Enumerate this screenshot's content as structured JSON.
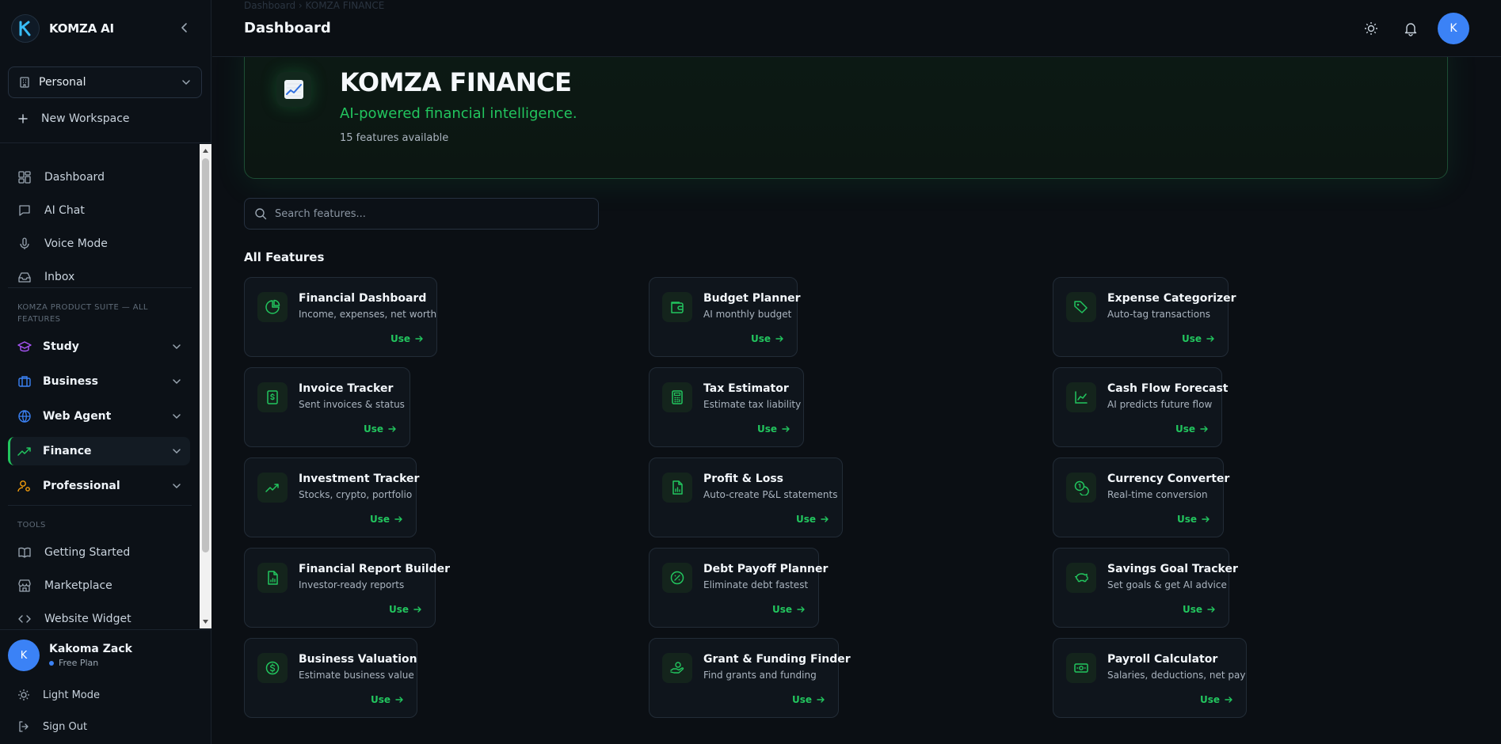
{
  "colors": {
    "accent": "#22c55e",
    "avatar": "#3b82f6",
    "background": "#0b0f14"
  },
  "brand": {
    "name": "KOMZA AI",
    "logo_letter": "K"
  },
  "sidebar": {
    "workspace": {
      "selected": "Personal"
    },
    "new_workspace": "New Workspace",
    "nav": [
      {
        "label": "Dashboard",
        "icon": "dashboard-icon"
      },
      {
        "label": "AI Chat",
        "icon": "chat-icon"
      },
      {
        "label": "Voice Mode",
        "icon": "microphone-icon"
      },
      {
        "label": "Inbox",
        "icon": "inbox-icon"
      }
    ],
    "suite_caption_line1": "KOMZA PRODUCT SUITE — ALL",
    "suite_caption_line2": "FEATURES",
    "categories": [
      {
        "label": "Study",
        "icon": "graduation-cap-icon",
        "color": "#a855f7"
      },
      {
        "label": "Business",
        "icon": "briefcase-icon",
        "color": "#3b82f6"
      },
      {
        "label": "Web Agent",
        "icon": "globe-icon",
        "color": "#3b82f6"
      },
      {
        "label": "Finance",
        "icon": "trending-up-icon",
        "color": "#22c55e",
        "active": true
      },
      {
        "label": "Professional",
        "icon": "user-cog-icon",
        "color": "#f59e0b"
      }
    ],
    "tools_caption": "TOOLS",
    "tools": [
      {
        "label": "Getting Started",
        "icon": "book-icon"
      },
      {
        "label": "Marketplace",
        "icon": "store-icon"
      },
      {
        "label": "Website Widget",
        "icon": "code-icon"
      }
    ],
    "user": {
      "initial": "K",
      "name": "Kakoma Zack",
      "plan": "Free Plan"
    },
    "light_mode": "Light Mode",
    "sign_out": "Sign Out"
  },
  "header": {
    "breadcrumb": "Dashboard  ›  KOMZA FINANCE",
    "title": "Dashboard",
    "avatar_initial": "K"
  },
  "hero": {
    "title": "KOMZA FINANCE",
    "subtitle": "AI-powered financial intelligence.",
    "count": "15 features available"
  },
  "search": {
    "placeholder": "Search features..."
  },
  "section_title": "All Features",
  "use_label": "Use",
  "features": [
    {
      "title": "Financial Dashboard",
      "desc": "Income, expenses, net worth",
      "icon": "pie-chart-icon"
    },
    {
      "title": "Budget Planner",
      "desc": "AI monthly budget",
      "icon": "wallet-icon"
    },
    {
      "title": "Expense Categorizer",
      "desc": "Auto-tag transactions",
      "icon": "tags-icon"
    },
    {
      "title": "Invoice Tracker",
      "desc": "Sent invoices & status",
      "icon": "receipt-icon"
    },
    {
      "title": "Tax Estimator",
      "desc": "Estimate tax liability",
      "icon": "calculator-icon"
    },
    {
      "title": "Cash Flow Forecast",
      "desc": "AI predicts future flow",
      "icon": "line-chart-icon"
    },
    {
      "title": "Investment Tracker",
      "desc": "Stocks, crypto, portfolio",
      "icon": "trending-up-icon"
    },
    {
      "title": "Profit & Loss",
      "desc": "Auto-create P&L statements",
      "icon": "file-chart-icon"
    },
    {
      "title": "Currency Converter",
      "desc": "Real-time conversion",
      "icon": "coins-icon"
    },
    {
      "title": "Financial Report Builder",
      "desc": "Investor-ready reports",
      "icon": "file-report-icon"
    },
    {
      "title": "Debt Payoff Planner",
      "desc": "Eliminate debt fastest",
      "icon": "percent-badge-icon"
    },
    {
      "title": "Savings Goal Tracker",
      "desc": "Set goals & get AI advice",
      "icon": "piggy-bank-icon"
    },
    {
      "title": "Business Valuation",
      "desc": "Estimate business value",
      "icon": "dollar-circle-icon"
    },
    {
      "title": "Grant & Funding Finder",
      "desc": "Find grants and funding",
      "icon": "hand-coins-icon"
    },
    {
      "title": "Payroll Calculator",
      "desc": "Salaries, deductions, net pay",
      "icon": "banknote-icon"
    }
  ]
}
